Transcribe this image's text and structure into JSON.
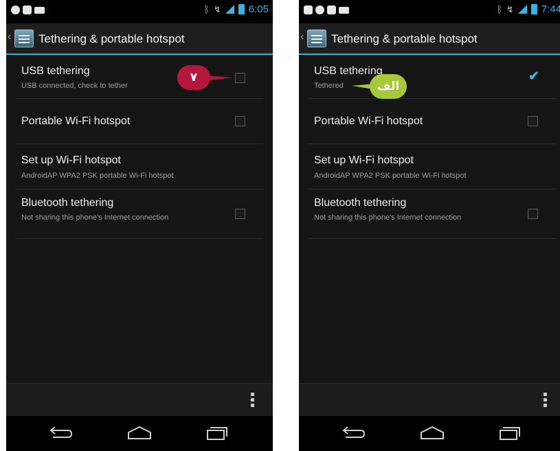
{
  "left_phone": {
    "status_time": "6:05",
    "title": "Tethering & portable hotspot",
    "items": [
      {
        "title": "USB tethering",
        "subtitle": "USB connected, check to tether",
        "checked": false
      },
      {
        "title": "Portable Wi-Fi hotspot",
        "subtitle": "",
        "checked": false
      },
      {
        "title": "Set up Wi-Fi hotspot",
        "subtitle": "AndroidAP WPA2 PSK portable Wi-Fi hotspot"
      },
      {
        "title": "Bluetooth tethering",
        "subtitle": "Not sharing this phone's Internet connection",
        "checked": false
      }
    ]
  },
  "right_phone": {
    "status_time": "7:44",
    "title": "Tethering & portable hotspot",
    "items": [
      {
        "title": "USB tethering",
        "subtitle": "Tethered",
        "checked": true
      },
      {
        "title": "Portable Wi-Fi hotspot",
        "subtitle": "",
        "checked": false
      },
      {
        "title": "Set up Wi-Fi hotspot",
        "subtitle": "AndroidAP WPA2 PSK portable Wi-Fi hotspot"
      },
      {
        "title": "Bluetooth tethering",
        "subtitle": "Not sharing this phone's Internet connection",
        "checked": false
      }
    ]
  },
  "callouts": {
    "red_label": "۷",
    "green_label": "الف"
  },
  "icons": {
    "status_bluetooth": "bluetooth-icon",
    "status_wifi": "wifi-icon",
    "status_signal": "signal-icon",
    "status_battery": "battery-icon",
    "nav_back": "back-icon",
    "nav_home": "home-icon",
    "nav_recent": "recent-apps-icon",
    "menu": "overflow-menu-icon"
  },
  "colors": {
    "accent": "#33b5e5",
    "background": "#151515",
    "callout_red": "#b5163c",
    "callout_green": "#a6c83a"
  }
}
